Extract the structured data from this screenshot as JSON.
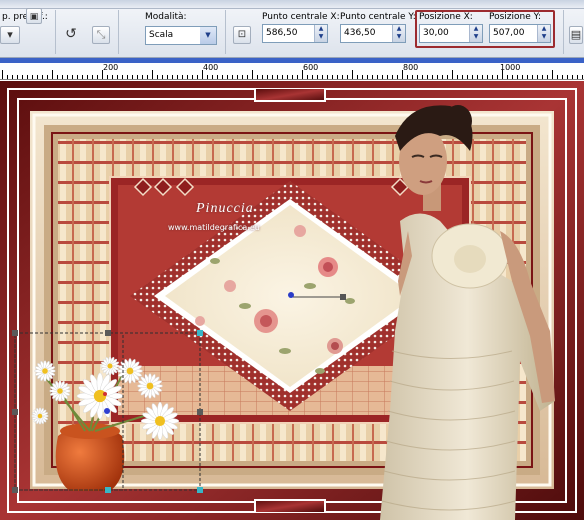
{
  "toolbar": {
    "preset_label": "p. predef.:",
    "mode_label": "Modalità:",
    "mode_value": "Scala",
    "center_x_label": "Punto centrale X:",
    "center_x_value": "586,50",
    "center_y_label": "Punto centrale Y:",
    "center_y_value": "436,50",
    "pos_x_label": "Posizione X:",
    "pos_x_value": "30,00",
    "pos_y_label": "Posizione Y:",
    "pos_y_value": "507,00",
    "highlight_color": "#9c2b2f"
  },
  "ruler": {
    "labels": [
      "200",
      "400",
      "600",
      "800",
      "1000"
    ]
  },
  "canvas": {
    "watermark_title": "Pinuccia",
    "watermark_sub": "www.matildegrafica.eu",
    "colors": {
      "frame_red": "#8e1d1d",
      "cream": "#f1e5cf",
      "beige": "#d9bf99",
      "selection": "#2f6fd0"
    }
  }
}
